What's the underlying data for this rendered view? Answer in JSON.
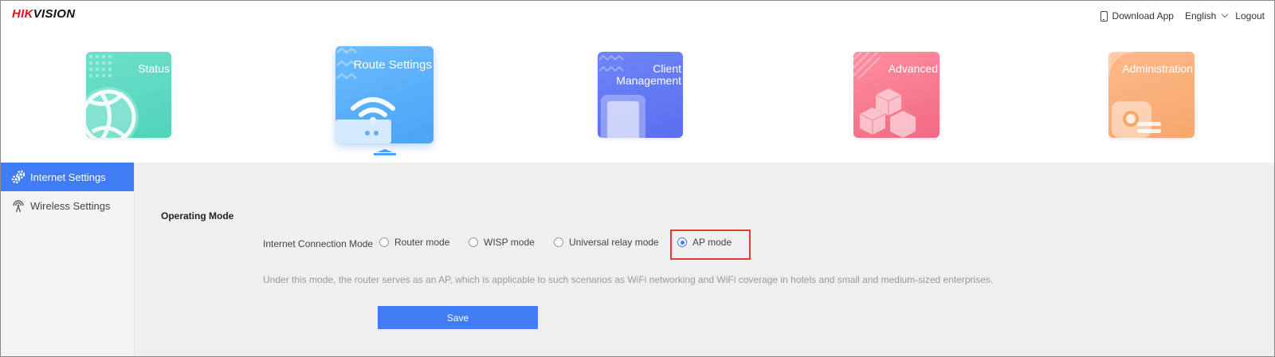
{
  "brand": {
    "logo_red": "HIK",
    "logo_dark": "VISION"
  },
  "topbar": {
    "download_app": "Download App",
    "language": "English",
    "logout": "Logout"
  },
  "modules": [
    {
      "label": "Status",
      "icon": "globe-icon",
      "active": false
    },
    {
      "label": "Route Settings",
      "icon": "wifi-router-icon",
      "active": true
    },
    {
      "label": "Client Management",
      "icon": "mobile-device-icon",
      "active": false
    },
    {
      "label": "Advanced",
      "icon": "cubes-icon",
      "active": false
    },
    {
      "label": "Administration",
      "icon": "gear-icon",
      "active": false
    }
  ],
  "sidebar": {
    "items": [
      {
        "label": "Internet Settings",
        "icon": "gears-icon",
        "active": true
      },
      {
        "label": "Wireless Settings",
        "icon": "antenna-icon",
        "active": false
      }
    ]
  },
  "main": {
    "section_title": "Operating Mode",
    "field_label": "Internet Connection Mode",
    "options": [
      {
        "label": "Router mode",
        "checked": false
      },
      {
        "label": "WISP mode",
        "checked": false
      },
      {
        "label": "Universal relay mode",
        "checked": false
      },
      {
        "label": "AP mode",
        "checked": true
      }
    ],
    "description": "Under this mode, the router serves as an AP, which is applicable to such scenarios as WiFi networking and WiFi coverage in hotels and small and medium-sized enterprises.",
    "save_label": "Save"
  },
  "colors": {
    "accent": "#3f7cf6",
    "brand_red": "#d7191e",
    "highlight": "#e53935"
  }
}
